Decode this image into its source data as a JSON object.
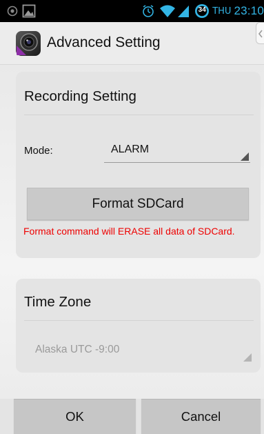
{
  "status_bar": {
    "day": "THU",
    "time": "23:10",
    "battery_level": "34",
    "icons": [
      "notification-icon",
      "image-icon",
      "alarm-icon",
      "wifi-icon",
      "signal-icon",
      "battery-icon"
    ],
    "accent_color": "#33b5e5"
  },
  "header": {
    "title": "Advanced Setting",
    "logo_icon": "app-logo-icon"
  },
  "recording": {
    "title": "Recording Setting",
    "mode_label": "Mode:",
    "mode_value": "ALARM",
    "format_button": "Format SDCard",
    "warning": "Format command will ERASE all data of SDCard.",
    "warning_color": "#ee0000"
  },
  "timezone": {
    "title": "Time Zone",
    "value": "Alaska UTC -9:00"
  },
  "buttons": {
    "ok": "OK",
    "cancel": "Cancel"
  }
}
